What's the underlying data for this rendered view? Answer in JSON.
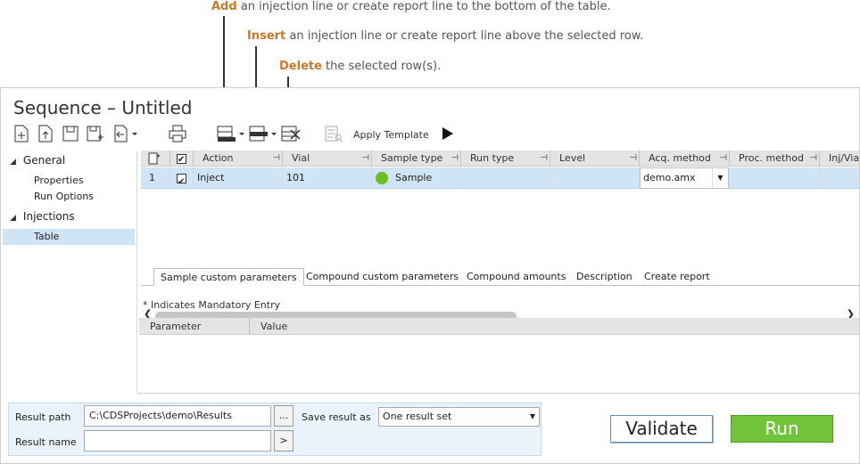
{
  "callouts": {
    "add_bold": "Add",
    "add_text": " an injection line or create report line to the bottom of the table.",
    "insert_bold": "Insert",
    "insert_text": " an injection line or create report line above the selected row.",
    "delete_bold": "Delete",
    "delete_text": " the selected row(s)."
  },
  "window": {
    "title": "Sequence – Untitled"
  },
  "toolbar": {
    "icons": [
      "new-file-icon",
      "open-file-icon",
      "save-icon",
      "save-as-icon",
      "import-icon",
      "print-icon",
      "add-row-icon",
      "insert-row-icon",
      "delete-row-icon",
      "apply-template-icon",
      "run-play-icon"
    ],
    "apply_template_label": "Apply Template"
  },
  "sidebar": {
    "groups": [
      {
        "label": "General",
        "items": [
          "Properties",
          "Run Options"
        ]
      },
      {
        "label": "Injections",
        "items": [
          "Table"
        ]
      }
    ],
    "selected": "Table"
  },
  "grid": {
    "columns": [
      "Action",
      "Vial",
      "Sample type",
      "Run type",
      "Level",
      "Acq. method",
      "Proc. method",
      "Inj/Via"
    ],
    "rows": [
      {
        "num": "1",
        "checked": true,
        "action": "Inject",
        "vial": "101",
        "sample_type": "Sample",
        "run_type": "",
        "level": "",
        "acq_method": "demo.amx",
        "proc_method": "",
        "inj_vial": ""
      }
    ],
    "sample_color": "#6bbf1f"
  },
  "tabs": [
    "Sample custom parameters",
    "Compound custom parameters",
    "Compound amounts",
    "Description",
    "Create report"
  ],
  "active_tab": "Sample custom parameters",
  "params": {
    "mandatory_note": "* Indicates Mandatory Entry",
    "columns": [
      "Parameter",
      "Value"
    ]
  },
  "bottom": {
    "result_path_label": "Result path",
    "result_path_value": "C:\\CDSProjects\\demo\\Results",
    "browse_label": "...",
    "result_name_label": "Result name",
    "result_name_value": "",
    "name_btn_label": ">",
    "save_result_label": "Save result as",
    "save_result_value": "One result set"
  },
  "buttons": {
    "validate": "Validate",
    "run": "Run"
  },
  "colors": {
    "accent_orange": "#c8782a",
    "run_green": "#71c43a",
    "selection_blue": "#cfe5f5"
  }
}
